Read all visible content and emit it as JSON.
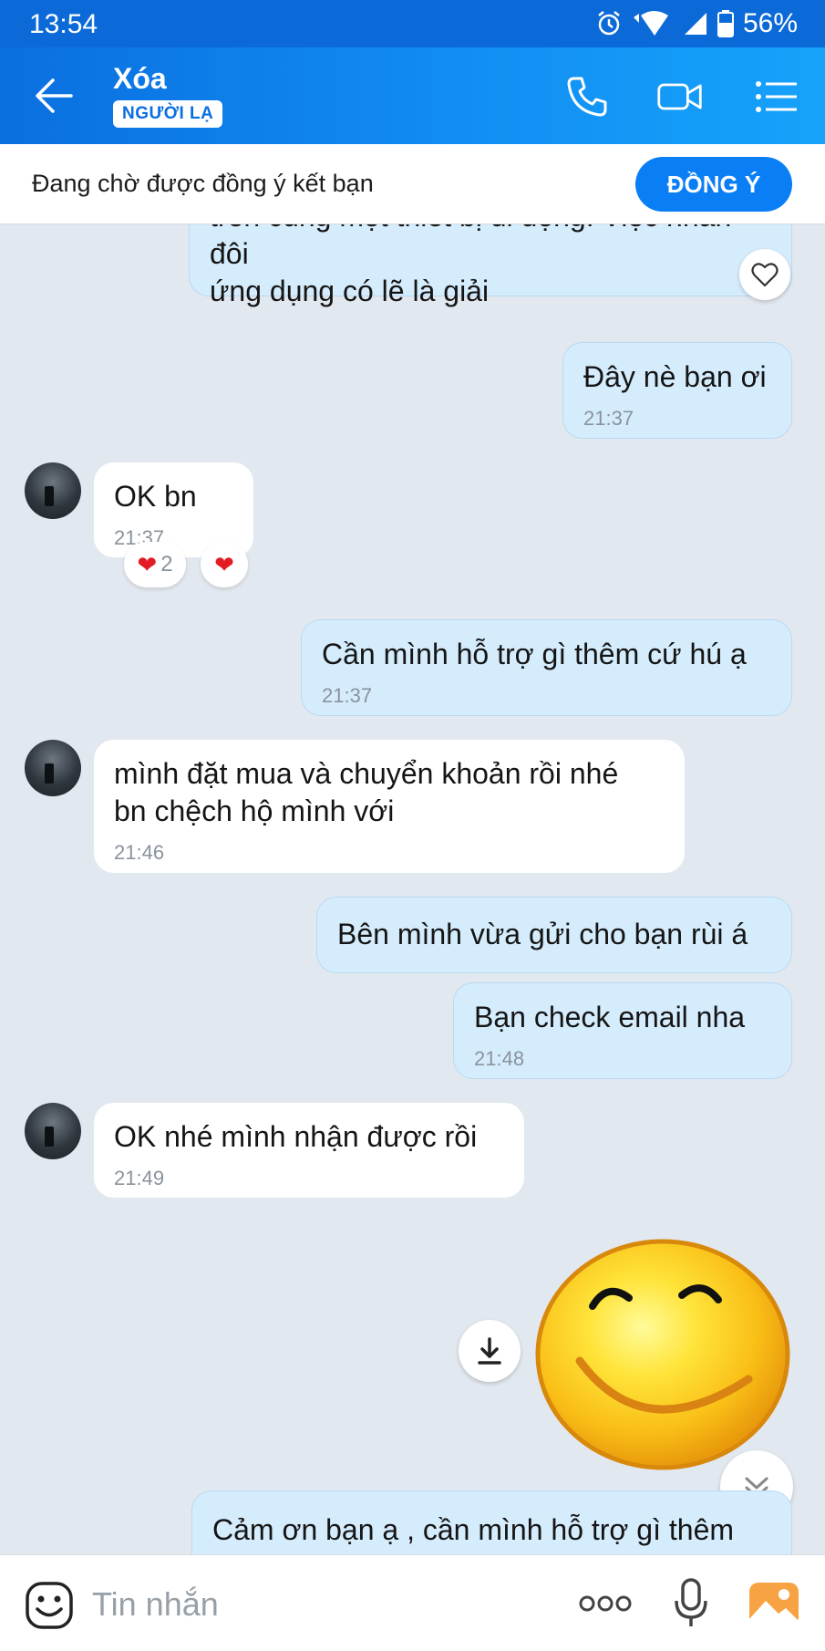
{
  "status_bar": {
    "time": "13:54",
    "battery": "56%"
  },
  "header": {
    "contact_name": "Xóa",
    "badge": "NGƯỜI LẠ",
    "icons": [
      "back-arrow-icon",
      "phone-icon",
      "video-call-icon",
      "menu-list-icon"
    ]
  },
  "friend_request": {
    "text": "Đang chờ được đồng ý kết bạn",
    "button": "ĐỒNG Ý"
  },
  "messages": [
    {
      "direction": "out",
      "text_top": "trên cùng một thiết bị di động. Việc nhân đôi",
      "text": "ứng dụng có lẽ là giải",
      "time": ""
    },
    {
      "direction": "out",
      "text": "Đây nè bạn ơi",
      "time": "21:37"
    },
    {
      "direction": "in",
      "text": "OK bn",
      "time": "21:37",
      "reaction_count": "2"
    },
    {
      "direction": "out",
      "text": "Cần mình hỗ trợ gì thêm cứ hú ạ",
      "time": "21:37"
    },
    {
      "direction": "in",
      "text_line1": "mình đặt mua và chuyển khoản rồi nhé",
      "text_line2": "bn chệch hộ mình với",
      "time": "21:46"
    },
    {
      "direction": "out",
      "text": "Bên mình vừa gửi cho bạn rùi á",
      "time": ""
    },
    {
      "direction": "out",
      "text": "Bạn check email nha",
      "time": "21:48"
    },
    {
      "direction": "in",
      "text": "OK nhé mình nhận được rồi",
      "time": "21:49"
    },
    {
      "direction": "out",
      "type": "sticker",
      "sticker": "smiley-sticker"
    },
    {
      "direction": "out",
      "text": "Cảm ơn bạn ạ , cần mình hỗ trợ gì thêm",
      "time": ""
    }
  ],
  "input": {
    "placeholder": "Tin nhắn"
  },
  "colors": {
    "header": "#0a6fe0",
    "outgoing_bubble": "#d5ecfd",
    "incoming_bubble": "#ffffff",
    "chat_bg": "#e2e8ef",
    "accent": "#0a7ff5",
    "heart": "#e31b23"
  }
}
